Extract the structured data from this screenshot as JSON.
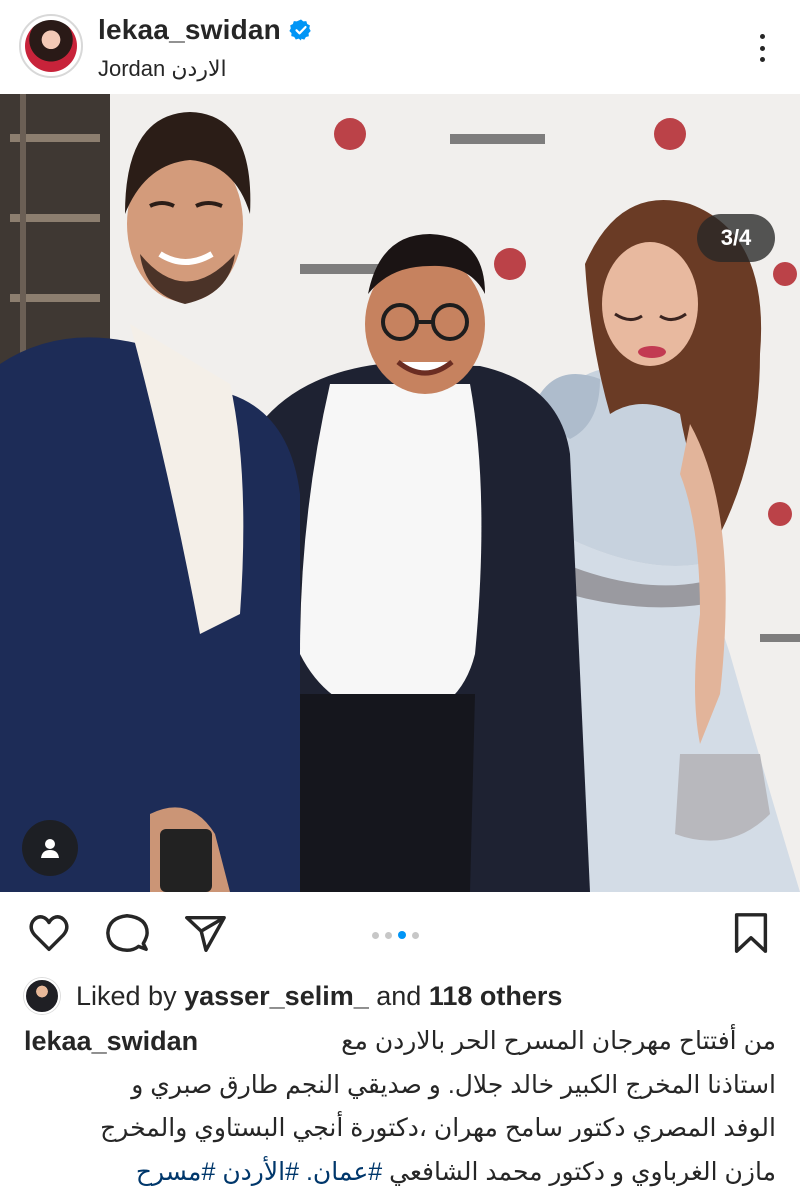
{
  "header": {
    "username": "lekaa_swidan",
    "location": "Jordan الاردن",
    "avatar_icon": "profile-avatar",
    "verified_icon": "verified-badge-icon",
    "menu_icon": "more-options-icon"
  },
  "photo": {
    "counter": "3/4",
    "tag_icon": "tagged-people-icon"
  },
  "actions": {
    "like_icon": "heart-icon",
    "comment_icon": "comment-icon",
    "share_icon": "send-icon",
    "save_icon": "bookmark-icon",
    "carousel_total": 4,
    "carousel_active": 3
  },
  "likes": {
    "prefix": "Liked by ",
    "user": "yasser_selim_",
    "middle": " and ",
    "others": "118 others"
  },
  "caption": {
    "username": "lekaa_swidan",
    "line1": "من أفتتاح مهرجان المسرح الحر بالاردن  مع",
    "line2": "استاذنا المخرج الكبير خالد جلال. و صديقي النجم طارق صبري و",
    "line3": "الوفد المصري دكتور سامح مهران ،دكتورة أنجي البستاوي والمخرج",
    "line4_text": "مازن الغرباوي و دكتور محمد الشافعي",
    "hashtag1": "#عمان.",
    "hashtag2": "#الأردن",
    "hashtag3": "#مسرح"
  },
  "colors": {
    "accent_blue": "#0095f6",
    "hashtag_blue": "#00376b",
    "text": "#262626",
    "verified_blue": "#0095f6"
  }
}
